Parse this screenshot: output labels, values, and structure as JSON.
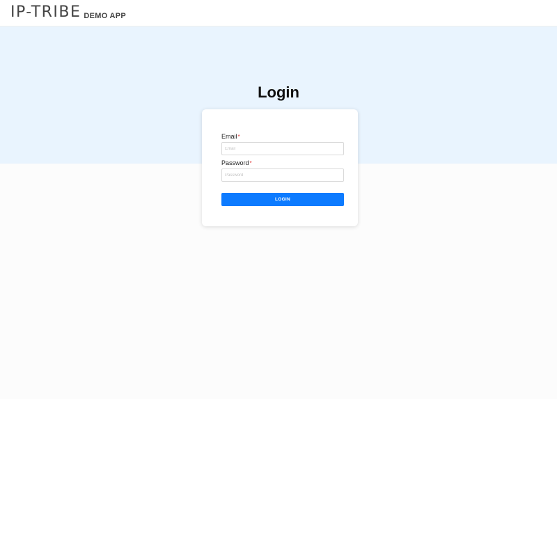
{
  "header": {
    "logo_text": "IP-TRIBE",
    "logo_subtitle": "DEMO APP"
  },
  "login": {
    "title": "Login",
    "email": {
      "label": "Email",
      "required_marker": "*",
      "placeholder": "Email",
      "value": ""
    },
    "password": {
      "label": "Password",
      "required_marker": "*",
      "placeholder": "Password",
      "value": ""
    },
    "submit_label": "LOGIN"
  },
  "colors": {
    "band_background": "#e9f4fe",
    "button_primary": "#0d7bff",
    "required_marker": "#e03131"
  }
}
